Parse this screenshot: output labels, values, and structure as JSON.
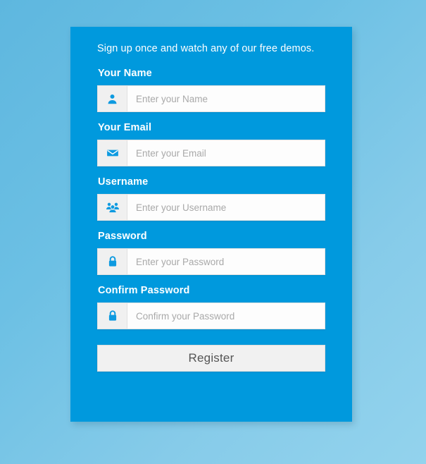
{
  "theme": {
    "card_blue": "#0099dd",
    "page_bg_from": "#5eb7df",
    "page_bg_to": "#93d3ed",
    "icon_blue": "#0d9ae0",
    "button_bg": "#f1f1f1",
    "button_text": "#555555",
    "placeholder_color": "#a9a9a9"
  },
  "form": {
    "intro": "Sign up once and watch any of our free demos.",
    "fields": [
      {
        "label": "Your Name",
        "placeholder": "Enter your Name",
        "value": "",
        "icon": "user-icon",
        "name": "name"
      },
      {
        "label": "Your Email",
        "placeholder": "Enter your Email",
        "value": "",
        "icon": "envelope-icon",
        "name": "email"
      },
      {
        "label": "Username",
        "placeholder": "Enter your Username",
        "value": "",
        "icon": "users-icon",
        "name": "username"
      },
      {
        "label": "Password",
        "placeholder": "Enter your Password",
        "value": "",
        "icon": "lock-icon",
        "name": "password"
      },
      {
        "label": "Confirm Password",
        "placeholder": "Confirm your Password",
        "value": "",
        "icon": "lock-icon",
        "name": "confirm-password"
      }
    ],
    "submit_label": "Register"
  }
}
